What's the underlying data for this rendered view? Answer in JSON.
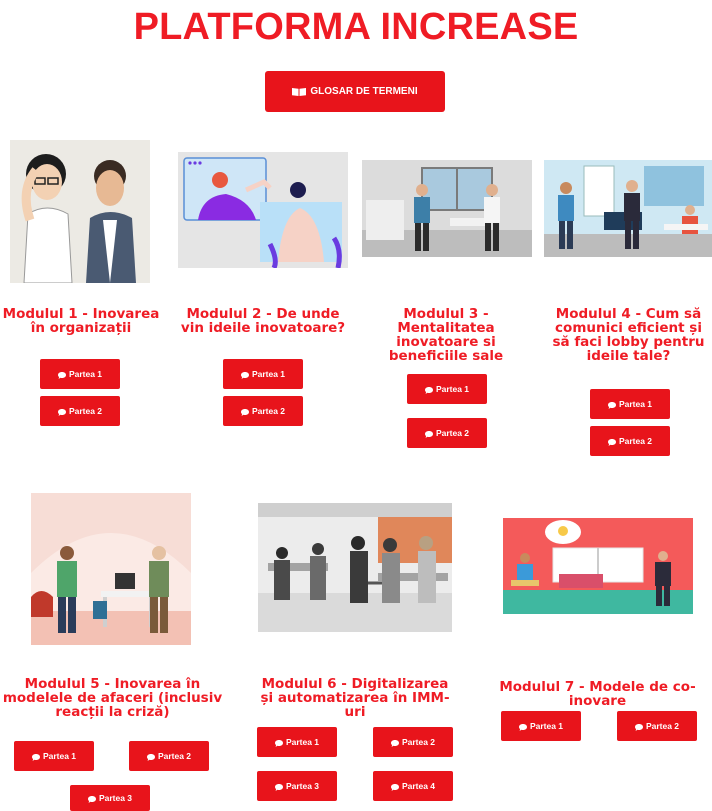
{
  "header": {
    "title": "PLATFORMA INCREASE",
    "glossary_label": "GLOSAR DE TERMENI"
  },
  "colors": {
    "accent": "#ef1c25",
    "button": "#e8141b"
  },
  "icons": {
    "glossary": "book-icon",
    "part": "chat-bubble-icon"
  },
  "modules": [
    {
      "title": "Modulul 1 - Inovarea în organizații",
      "parts": [
        "Partea 1",
        "Partea 2"
      ]
    },
    {
      "title": "Modulul 2 - De unde vin ideile inovatoare?",
      "parts": [
        "Partea 1",
        "Partea 2"
      ]
    },
    {
      "title": "Modulul 3 - Mentalitatea inovatoare si beneficiile sale",
      "parts": [
        "Partea 1",
        "Partea 2"
      ]
    },
    {
      "title": "Modulul 4 - Cum să comunici eficient și să faci lobby pentru ideile tale?",
      "parts": [
        "Partea 1",
        "Partea 2"
      ]
    },
    {
      "title": "Modulul 5 - Inovarea în modelele de afaceri (inclusiv reacții la criză)",
      "parts": [
        "Partea 1",
        "Partea 2",
        "Partea 3"
      ]
    },
    {
      "title": "Modulul 6 - Digitalizarea și automatizarea în IMM-uri",
      "parts": [
        "Partea 1",
        "Partea 2",
        "Partea 3",
        "Partea 4"
      ]
    },
    {
      "title": "Modulul 7 - Modele de co-inovare",
      "parts": [
        "Partea 1",
        "Partea 2"
      ]
    }
  ]
}
